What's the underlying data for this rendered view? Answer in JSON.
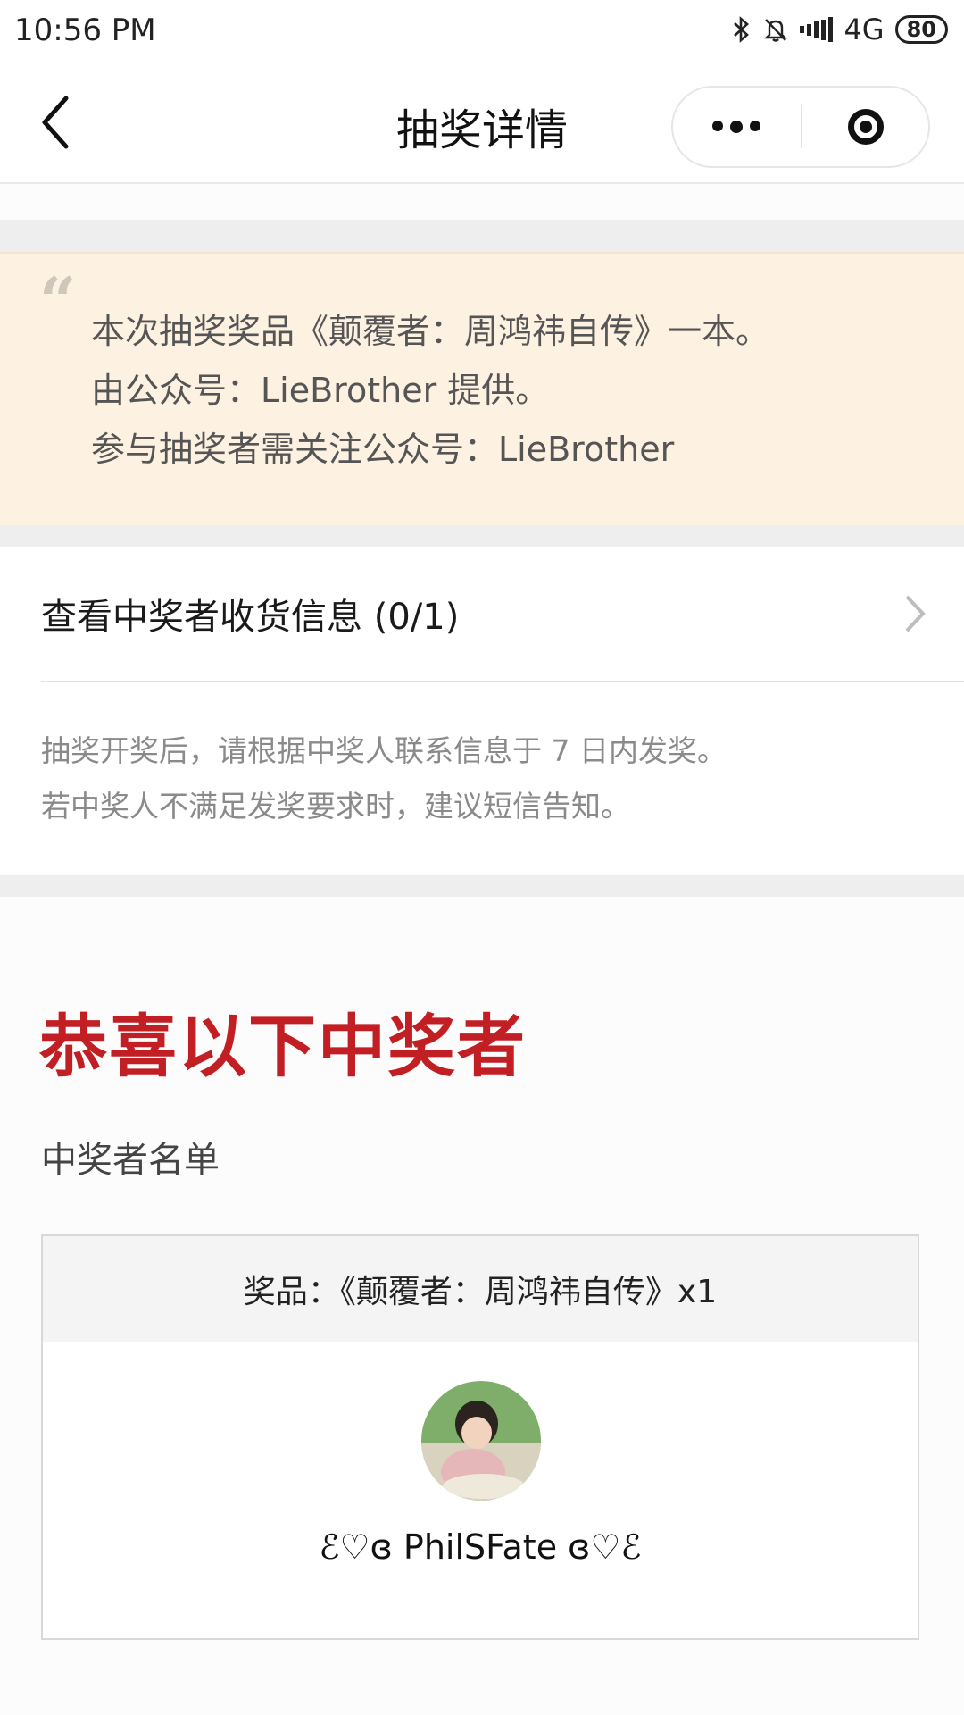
{
  "status_bar": {
    "time": "10:56 PM",
    "network": "4G",
    "battery": "80",
    "icons": [
      "bluetooth-icon",
      "bell-muted-icon",
      "signal-icon",
      "battery-icon"
    ]
  },
  "nav": {
    "title": "抽奖详情",
    "icons": [
      "back-arrow-icon",
      "more-dots-icon",
      "close-target-icon"
    ]
  },
  "description": {
    "lines": [
      "本次抽奖奖品《颠覆者：周鸿祎自传》一本。",
      "由公众号：LieBrother 提供。",
      "参与抽奖者需关注公众号：LieBrother"
    ]
  },
  "shipping": {
    "label": "查看中奖者收货信息 (0/1)"
  },
  "notice": {
    "lines": [
      "抽奖开奖后，请根据中奖人联系信息于 7 日内发奖。",
      "若中奖人不满足发奖要求时，建议短信告知。"
    ]
  },
  "winners": {
    "title": "恭喜以下中奖者",
    "subtitle": "中奖者名单",
    "prize": "奖品：《颠覆者：周鸿祎自传》x1",
    "winner_name": "ℰ♡ɞ PhilSFate ɞ♡ℰ"
  },
  "colors": {
    "accent_red": "#c21f24",
    "quote_bg": "#fdf1e2"
  }
}
